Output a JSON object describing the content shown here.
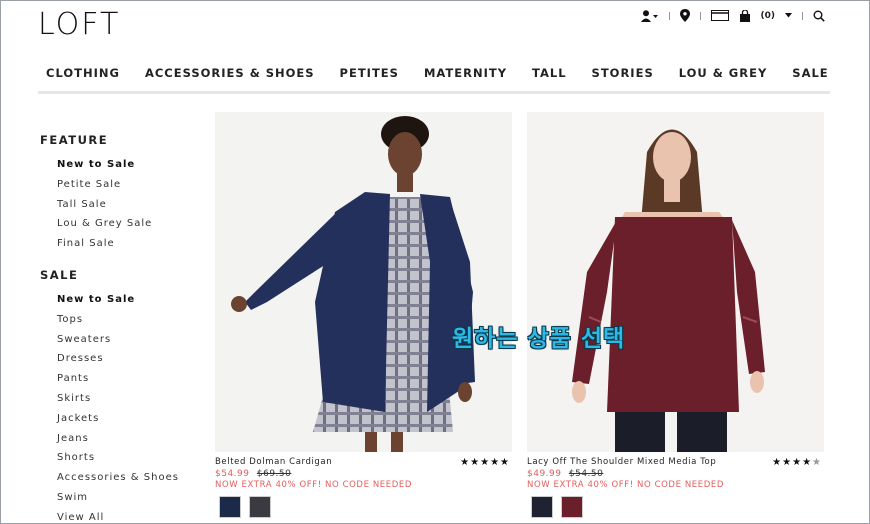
{
  "brand": {
    "logo": "LOFT"
  },
  "utility": {
    "cart_count": "(0)"
  },
  "nav": [
    "CLOTHING",
    "ACCESSORIES & SHOES",
    "PETITES",
    "MATERNITY",
    "TALL",
    "STORIES",
    "LOU & GREY",
    "SALE"
  ],
  "sidebar": {
    "feature_title": "FEATURE",
    "feature_items": [
      {
        "label": "New to Sale",
        "active": true
      },
      {
        "label": "Petite Sale",
        "active": false
      },
      {
        "label": "Tall Sale",
        "active": false
      },
      {
        "label": "Lou & Grey Sale",
        "active": false
      },
      {
        "label": "Final Sale",
        "active": false
      }
    ],
    "sale_title": "SALE",
    "sale_items": [
      {
        "label": "New to Sale",
        "active": true
      },
      {
        "label": "Tops",
        "active": false
      },
      {
        "label": "Sweaters",
        "active": false
      },
      {
        "label": "Dresses",
        "active": false
      },
      {
        "label": "Pants",
        "active": false
      },
      {
        "label": "Skirts",
        "active": false
      },
      {
        "label": "Jackets",
        "active": false
      },
      {
        "label": "Jeans",
        "active": false
      },
      {
        "label": "Shorts",
        "active": false
      },
      {
        "label": "Accessories & Shoes",
        "active": false
      },
      {
        "label": "Swim",
        "active": false
      },
      {
        "label": "View All",
        "active": false
      }
    ]
  },
  "products": [
    {
      "name": "Belted Dolman Cardigan",
      "price_sale": "$54.99",
      "price_original": "$69.50",
      "promo": "NOW EXTRA 40% OFF! NO CODE NEEDED",
      "rating": 5,
      "swatches": [
        "#1c2a4a",
        "#3a3a40"
      ]
    },
    {
      "name": "Lacy Off The Shoulder Mixed Media Top",
      "price_sale": "$49.99",
      "price_original": "$54.50",
      "promo": "NOW EXTRA 40% OFF! NO CODE NEEDED",
      "rating": 4.5,
      "swatches": [
        "#1f2230",
        "#6b1f2a"
      ]
    }
  ],
  "overlay_caption": "원하는 상품 선택",
  "colors": {
    "sale_red": "#e35d5d",
    "caption_cyan": "#2fb7e6"
  }
}
